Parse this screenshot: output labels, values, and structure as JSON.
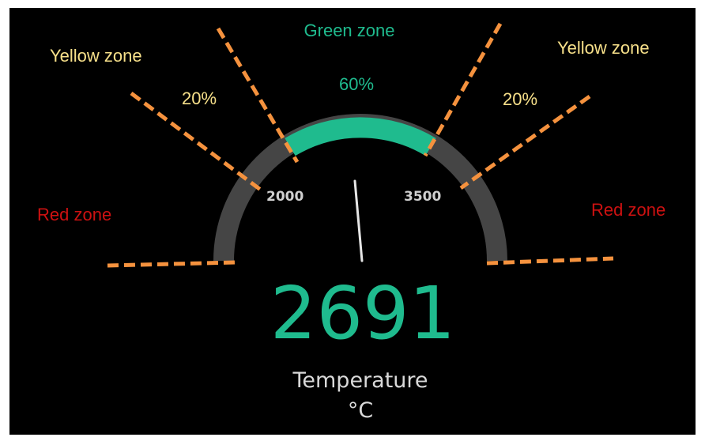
{
  "gauge": {
    "value": "2691",
    "label": "Temperature",
    "unit": "°C",
    "value_number": 2691,
    "range": [
      1250,
      4250
    ],
    "needle_fraction": 0.48,
    "thresholds": [
      {
        "label": "2000",
        "value": 2000
      },
      {
        "label": "3500",
        "value": 3500
      }
    ],
    "colors": {
      "track": "#454545",
      "active": "#1fbb8e",
      "value": "#1fbb8e",
      "caption": "#d9d9d9",
      "needle": "#e6e6e6",
      "background": "#000000"
    }
  },
  "annotations": {
    "green_zone": {
      "label": "Green zone",
      "percent": "60%",
      "color": "#1fbb8e"
    },
    "yellow_left": {
      "label": "Yellow zone",
      "percent": "20%",
      "color": "#f7e08a"
    },
    "yellow_right": {
      "label": "Yellow zone",
      "percent": "20%",
      "color": "#f7e08a"
    },
    "red_left": {
      "label": "Red zone",
      "color": "#cc1111"
    },
    "red_right": {
      "label": "Red zone",
      "color": "#cc1111"
    },
    "divider_color": "#f5923e"
  }
}
